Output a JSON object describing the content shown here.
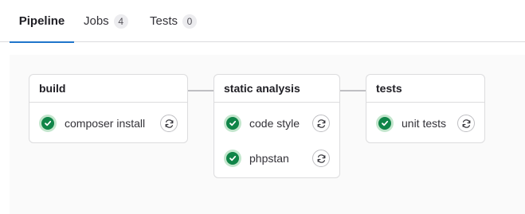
{
  "tabs": [
    {
      "label": "Pipeline",
      "active": true
    },
    {
      "label": "Jobs",
      "count": "4"
    },
    {
      "label": "Tests",
      "count": "0"
    }
  ],
  "stages": [
    {
      "title": "build",
      "jobs": [
        {
          "name": "composer install",
          "status": "passed",
          "action": "retry-icon"
        }
      ]
    },
    {
      "title": "static analysis",
      "jobs": [
        {
          "name": "code style",
          "status": "passed",
          "action": "retry-icon"
        },
        {
          "name": "phpstan",
          "status": "passed",
          "action": "retry-icon"
        }
      ]
    },
    {
      "title": "tests",
      "jobs": [
        {
          "name": "unit tests",
          "status": "passed",
          "action": "retry-icon"
        }
      ]
    }
  ],
  "colors": {
    "accent": "#1f75cb",
    "success": "#108548",
    "success_bg": "#c3e6cd",
    "graph_bg": "#fafafa"
  }
}
